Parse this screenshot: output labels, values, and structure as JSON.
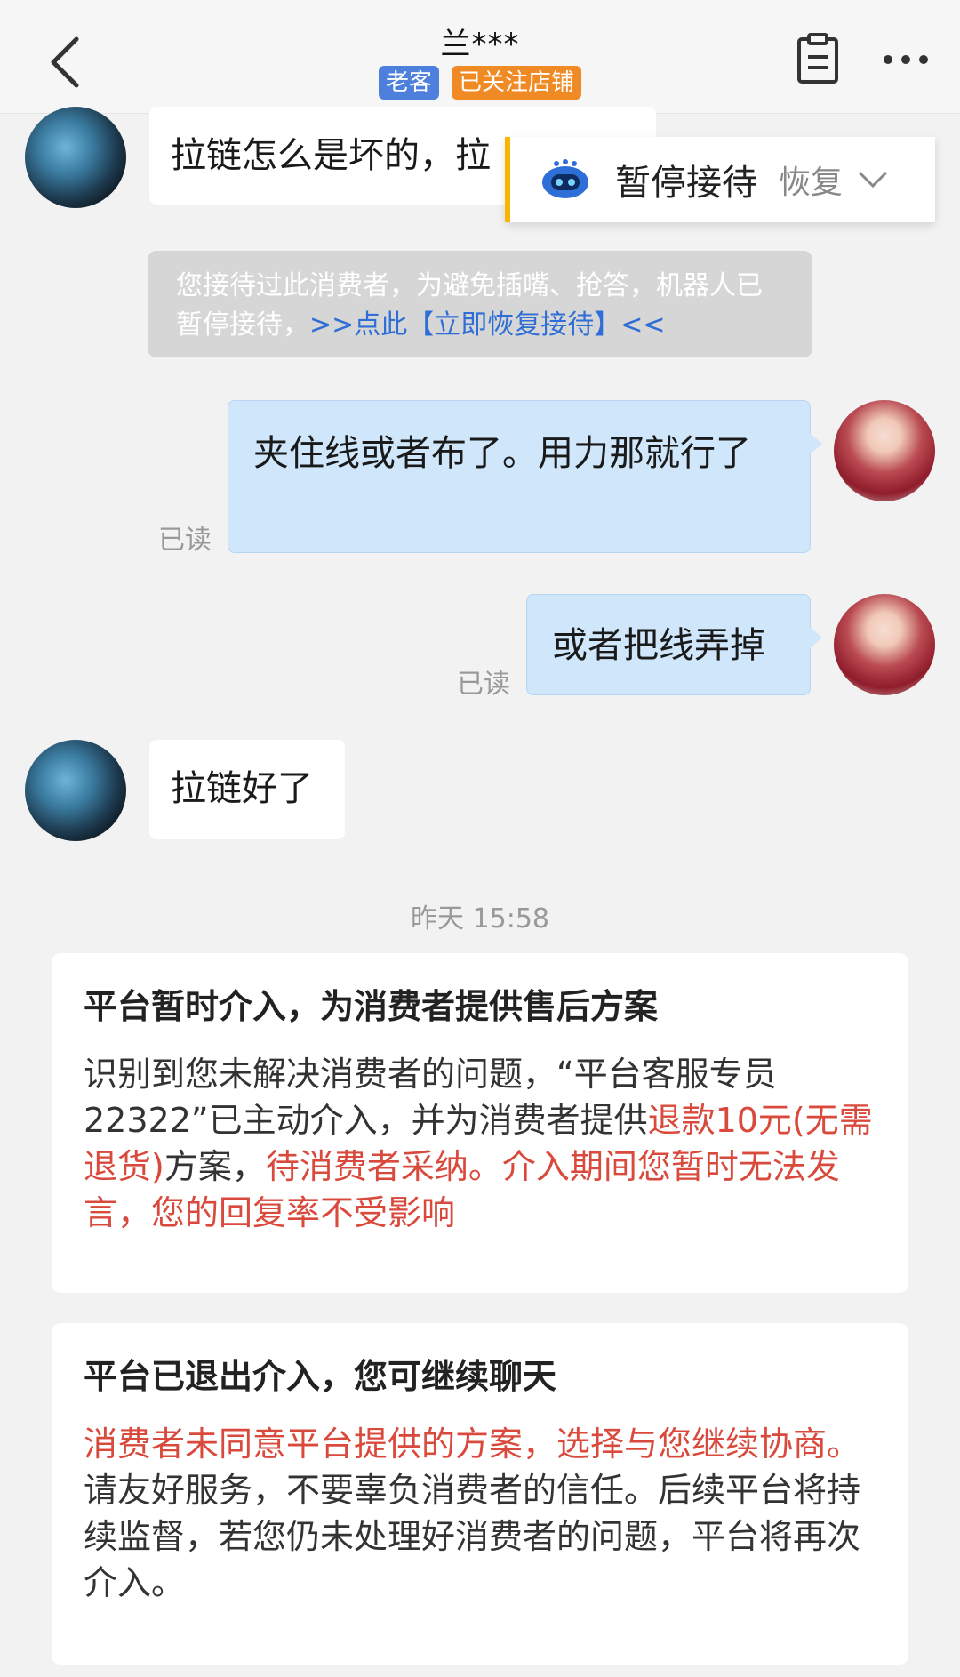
{
  "header": {
    "title": "兰***",
    "tags": [
      "老客",
      "已关注店铺"
    ]
  },
  "popup": {
    "pause_label": "暂停接待",
    "resume_label": "恢复"
  },
  "messages": {
    "m1": "拉链怎么是坏的，拉",
    "system_note_part1": "您接待过此消费者，为避免插嘴、抢答，机器人已暂停接待，",
    "system_note_link": ">>点此【立即恢复接待】<<",
    "m2": "夹住线或者布了。用力那就行了",
    "m3": "或者把线弄掉",
    "m4": "拉链好了",
    "read_label": "已读"
  },
  "timestamp": "昨天 15:58",
  "card1": {
    "title": "平台暂时介入，为消费者提供售后方案",
    "text_a": "识别到您未解决消费者的问题，“平台客服专员22322”已主动介入，并为消费者提供",
    "text_b": "退款10元(无需退货)",
    "text_c": "方案，",
    "text_d": "待消费者采纳。介入期间您暂时无法发言，您的回复率不受影响"
  },
  "card2": {
    "title": "平台已退出介入，您可继续聊天",
    "text_a": "消费者未同意平台提供的方案，选择与您继续协商。",
    "text_b": "请友好服务，不要辜负消费者的信任。后续平台将持续监督，若您仍未处理好消费者的问题，平台将再次介入。"
  },
  "colors": {
    "accent_red": "#d94a3d",
    "link_blue": "#2e6ed6",
    "bubble_blue": "#cfe6fb"
  }
}
